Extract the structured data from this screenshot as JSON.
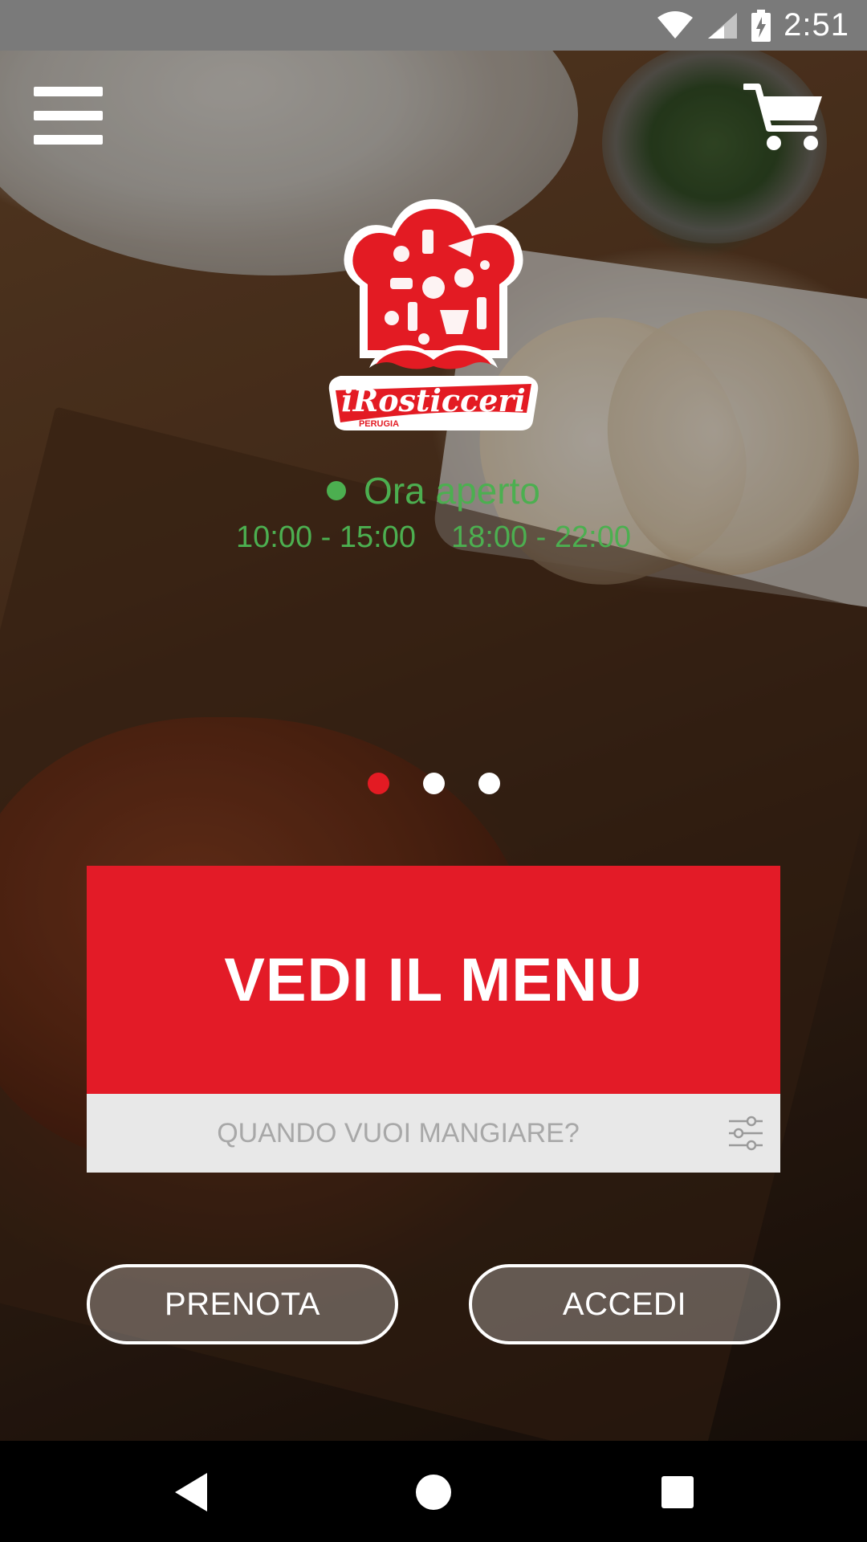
{
  "status_bar": {
    "time": "2:51",
    "icons": [
      "wifi-icon",
      "cellular-signal-icon",
      "battery-charging-icon"
    ]
  },
  "header": {
    "menu_icon": "hamburger-menu-icon",
    "cart_icon": "shopping-cart-icon"
  },
  "logo": {
    "brand_text": "iRosticceri",
    "sub_text": "PERUGIA"
  },
  "opening": {
    "status": "Ora aperto",
    "status_color": "#4caf50",
    "hours": [
      "10:00 - 15:00",
      "18:00 - 22:00"
    ]
  },
  "carousel": {
    "pages": 3,
    "active_index": 0,
    "active_color": "#e31b23"
  },
  "actions": {
    "menu_label": "VEDI IL MENU",
    "menu_color": "#e31b27",
    "when_placeholder": "QUANDO VUOI MANGIARE?",
    "filter_icon": "sliders-filter-icon",
    "book_label": "PRENOTA",
    "login_label": "ACCEDI"
  },
  "nav_bar": {
    "buttons": [
      "back-triangle-icon",
      "home-circle-icon",
      "recents-square-icon"
    ]
  }
}
